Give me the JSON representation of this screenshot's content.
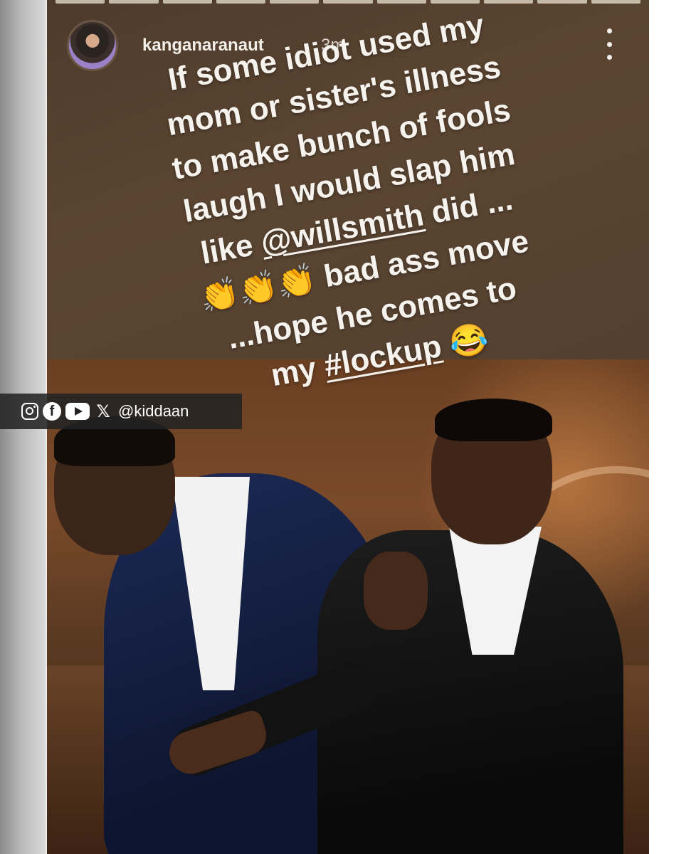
{
  "story": {
    "username": "kanganaranaut",
    "timestamp": "3m",
    "caption_lines": [
      "If some idiot used my",
      "mom or sister's illness",
      "to make bunch of fools",
      "laugh I would slap him",
      "like @willsmith did ...",
      "👏👏👏 bad ass move",
      "...hope he comes to",
      "my #lockup 😂"
    ],
    "caption_parts": {
      "line5_prefix": "like ",
      "mention": "@willsmith",
      "line5_suffix": " did ...",
      "line8_prefix": "my ",
      "hashtag": "#lockup",
      "line8_suffix": " 😂"
    },
    "icons": {
      "more": "more-vertical-icon"
    }
  },
  "watermark": {
    "handle": "@kiddaan",
    "icons": [
      "instagram-icon",
      "facebook-icon",
      "youtube-icon",
      "x-icon"
    ]
  },
  "colors": {
    "story_bg": "#54402f",
    "caption_text": "#f6f3ee",
    "watermark_bg": "#232323"
  }
}
